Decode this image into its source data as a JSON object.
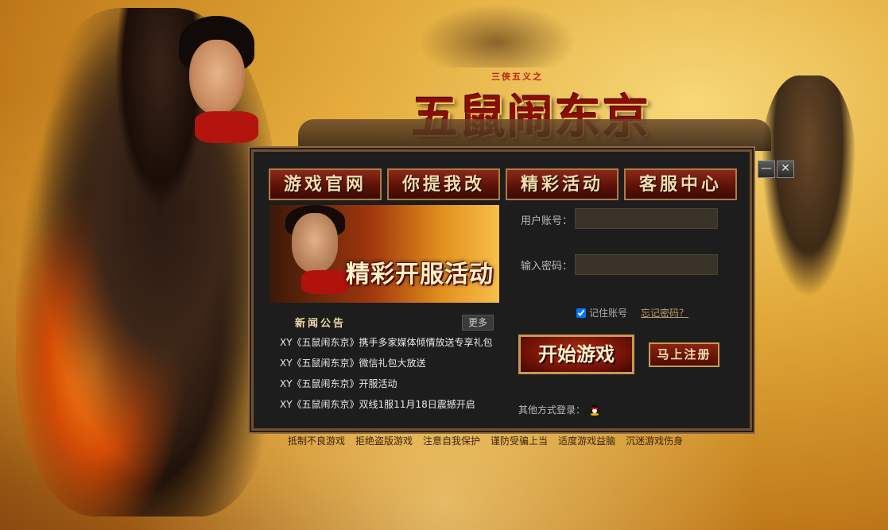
{
  "logo": {
    "subtitle": "三侠五义之",
    "title": "五鼠闹东京"
  },
  "window": {
    "minimize": "—",
    "close": "✕"
  },
  "nav": [
    {
      "label": "游戏官网"
    },
    {
      "label": "你提我改"
    },
    {
      "label": "精彩活动"
    },
    {
      "label": "客服中心"
    }
  ],
  "banner": {
    "text": "精彩开服活动"
  },
  "news": {
    "title": "新闻公告",
    "more": "更多",
    "items": [
      "XY《五鼠闹东京》携手多家媒体倾情放送专享礼包",
      "XY《五鼠闹东京》微信礼包大放送",
      "XY《五鼠闹东京》开服活动",
      "XY《五鼠闹东京》双线1服11月18日震撼开启"
    ]
  },
  "login": {
    "username_label": "用户账号：",
    "username_value": "",
    "password_label": "输入密码：",
    "password_value": "",
    "remember_label": "记住账号",
    "remember_checked": true,
    "forgot": "忘记密码？",
    "start": "开始游戏",
    "register": "马上注册",
    "other": "其他方式登录："
  },
  "footer": [
    "抵制不良游戏",
    "拒绝盗版游戏",
    "注意自我保护",
    "谨防受骗上当",
    "适度游戏益脑",
    "沉迷游戏伤身"
  ]
}
